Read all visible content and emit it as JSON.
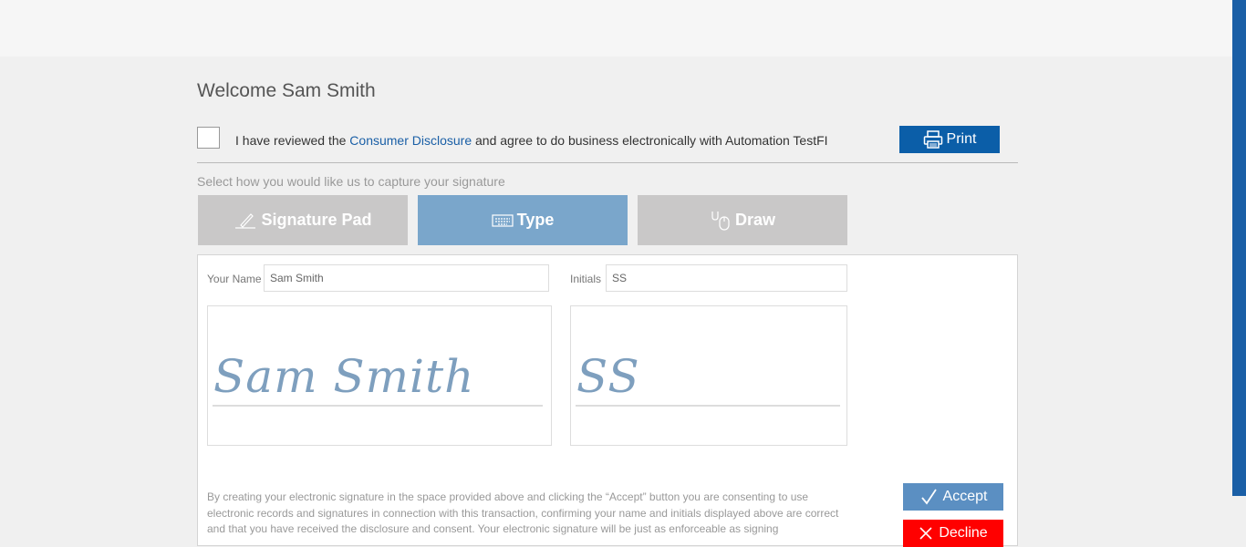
{
  "header": {
    "title": "Welcome Sam Smith"
  },
  "disclosure": {
    "prefix": "I have reviewed the ",
    "link": "Consumer Disclosure",
    "suffix": " and agree to do business electronically with Automation TestFI"
  },
  "print_label": "Print",
  "capture_prompt": "Select how you would like us to capture your signature",
  "tabs": [
    {
      "label": "Signature Pad",
      "icon": "pen-icon"
    },
    {
      "label": "Type",
      "icon": "keyboard-icon",
      "selected": true
    },
    {
      "label": "Draw",
      "icon": "mouse-icon"
    }
  ],
  "form": {
    "name_label": "Your Name",
    "name_value": "Sam Smith",
    "initials_label": "Initials",
    "initials_value": "SS"
  },
  "preview": {
    "signature": "Sam Smith",
    "initials": "SS"
  },
  "consent_text": "By creating your electronic signature in the space provided above and clicking the “Accept” button you are consenting to use electronic records and signatures in connection with this transaction, confirming your name and initials displayed above are correct and that you have received the disclosure and consent. Your electronic signature will be just as enforceable as signing",
  "actions": {
    "accept": "Accept",
    "decline": "Decline"
  },
  "colors": {
    "accent": "#0b5ea8",
    "tab_selected": "#7aa6cb",
    "tab_idle": "#c9c8c8",
    "decline": "#ff0000",
    "signature_ink": "#7e9fbe"
  }
}
